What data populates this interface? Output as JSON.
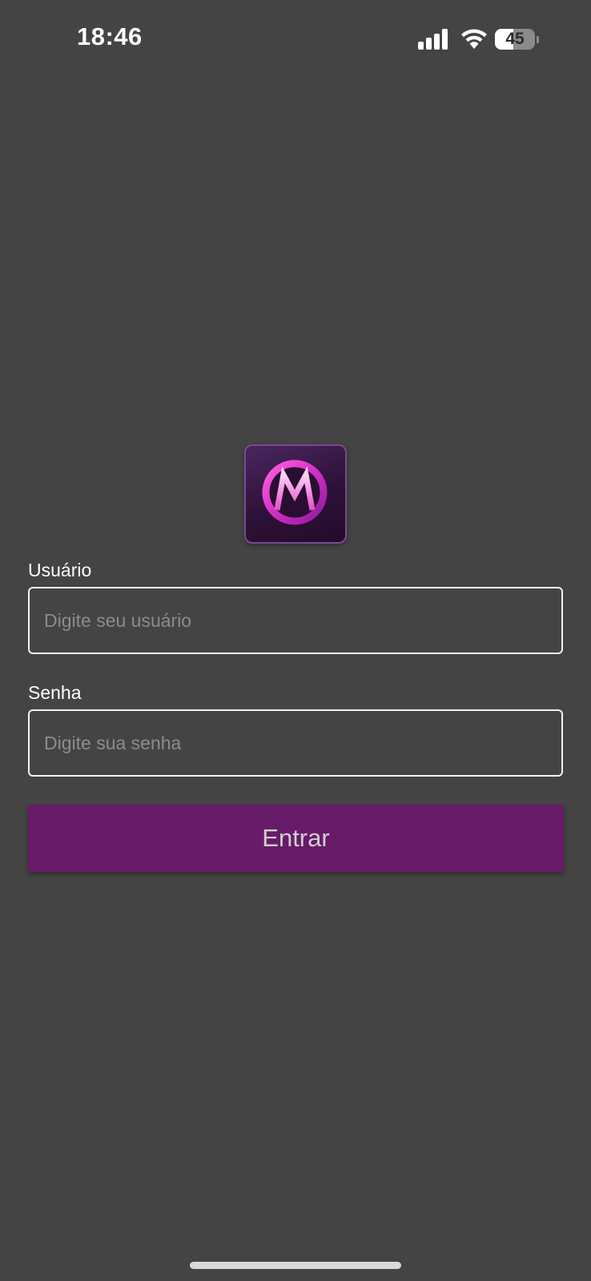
{
  "status_bar": {
    "time": "18:46",
    "battery_level": "45",
    "battery_fraction": 0.45,
    "icons": [
      "signal-bars-icon",
      "wifi-icon",
      "battery-icon"
    ]
  },
  "logo": {
    "icon": "m-logo-icon",
    "letter": "M"
  },
  "form": {
    "username_label": "Usuário",
    "username_placeholder": "Digite seu usuário",
    "username_value": "",
    "password_label": "Senha",
    "password_placeholder": "Digite sua senha",
    "password_value": "",
    "submit_label": "Entrar"
  },
  "colors": {
    "background": "#444444",
    "button": "#671b69",
    "button_text": "#cfcfcf",
    "placeholder": "#8c8c8c",
    "logo_accent": "#e040c8"
  }
}
